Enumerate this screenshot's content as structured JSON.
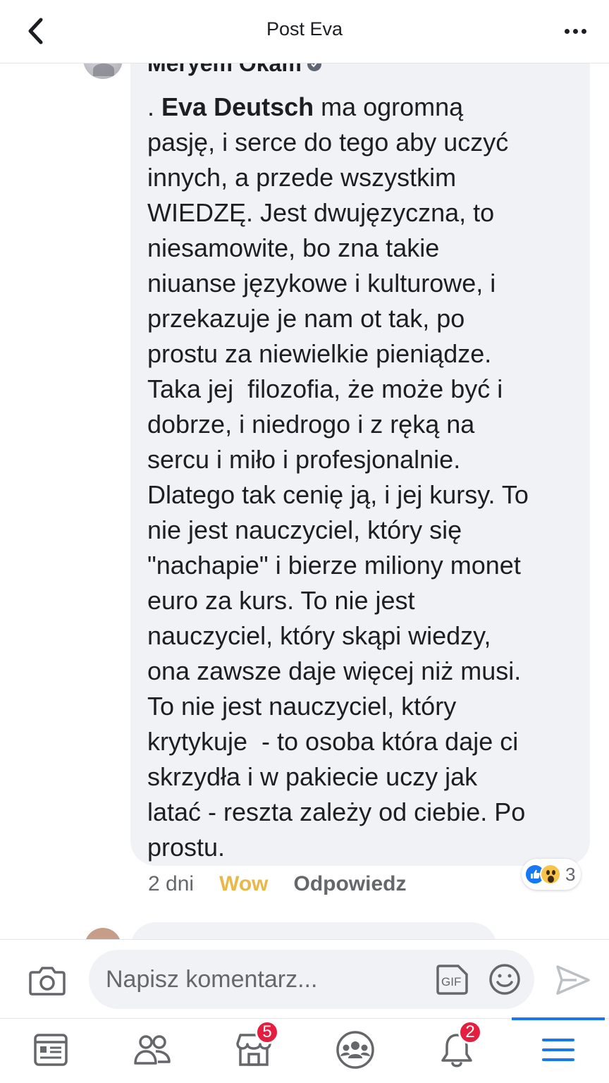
{
  "header": {
    "title": "Post Eva",
    "back_icon": "chevron-left-icon",
    "more_icon": "more-horizontal-icon"
  },
  "comment": {
    "author": "Meryem Okam",
    "mention": "Eva Deutsch",
    "text_prefix": ". ",
    "text_body": " ma ogromną\npasję, i serce do tego aby uczyć\ninnych, a przede wszystkim\nWIEDZĘ. Jest dwujęzyczna, to\nniesamowite, bo zna takie\nniuanse językowe i kulturowe, i\nprzekazuje je nam ot tak, po\nprostu za niewielkie pieniądze.\nTaka jej  filozofia, że może być i\ndobrze, i niedrogo i z ręką na\nsercu i miło i profesjonalnie.\nDlatego tak cenię ją, i jej kursy. To\nnie jest nauczyciel, który się\n\"nachapie\" i bierze miliony monet\neuro za kurs. To nie jest\nnauczyciel, który skąpi wiedzy,\nona zawsze daje więcej niż musi.\nTo nie jest nauczyciel, który\nkrytykuje  - to osoba która daje ci\nskrzydła i w pakiecie uczy jak\nlatać - reszta zależy od ciebie. Po\nprostu.",
    "time": "2 dni",
    "reaction_label": "Wow",
    "reply_label": "Odpowiedz",
    "reaction_count": "3",
    "reaction_icons": [
      "like-icon",
      "wow-icon"
    ],
    "wow_color": "#e8b84a"
  },
  "composer": {
    "placeholder": "Napisz komentarz...",
    "gif_label": "GIF",
    "icons": [
      "camera-icon",
      "gif-icon",
      "emoji-icon",
      "send-icon"
    ]
  },
  "tabbar": {
    "tabs": [
      {
        "name": "news-feed",
        "icon": "news-feed-icon",
        "badge": ""
      },
      {
        "name": "friends",
        "icon": "friends-icon",
        "badge": ""
      },
      {
        "name": "marketplace",
        "icon": "marketplace-icon",
        "badge": "5"
      },
      {
        "name": "groups",
        "icon": "groups-icon",
        "badge": ""
      },
      {
        "name": "notifications",
        "icon": "bell-icon",
        "badge": "2"
      },
      {
        "name": "menu",
        "icon": "menu-icon",
        "badge": ""
      }
    ],
    "active_tab": "menu",
    "accent_color": "#1877f2",
    "badge_color": "#e41e3f"
  }
}
